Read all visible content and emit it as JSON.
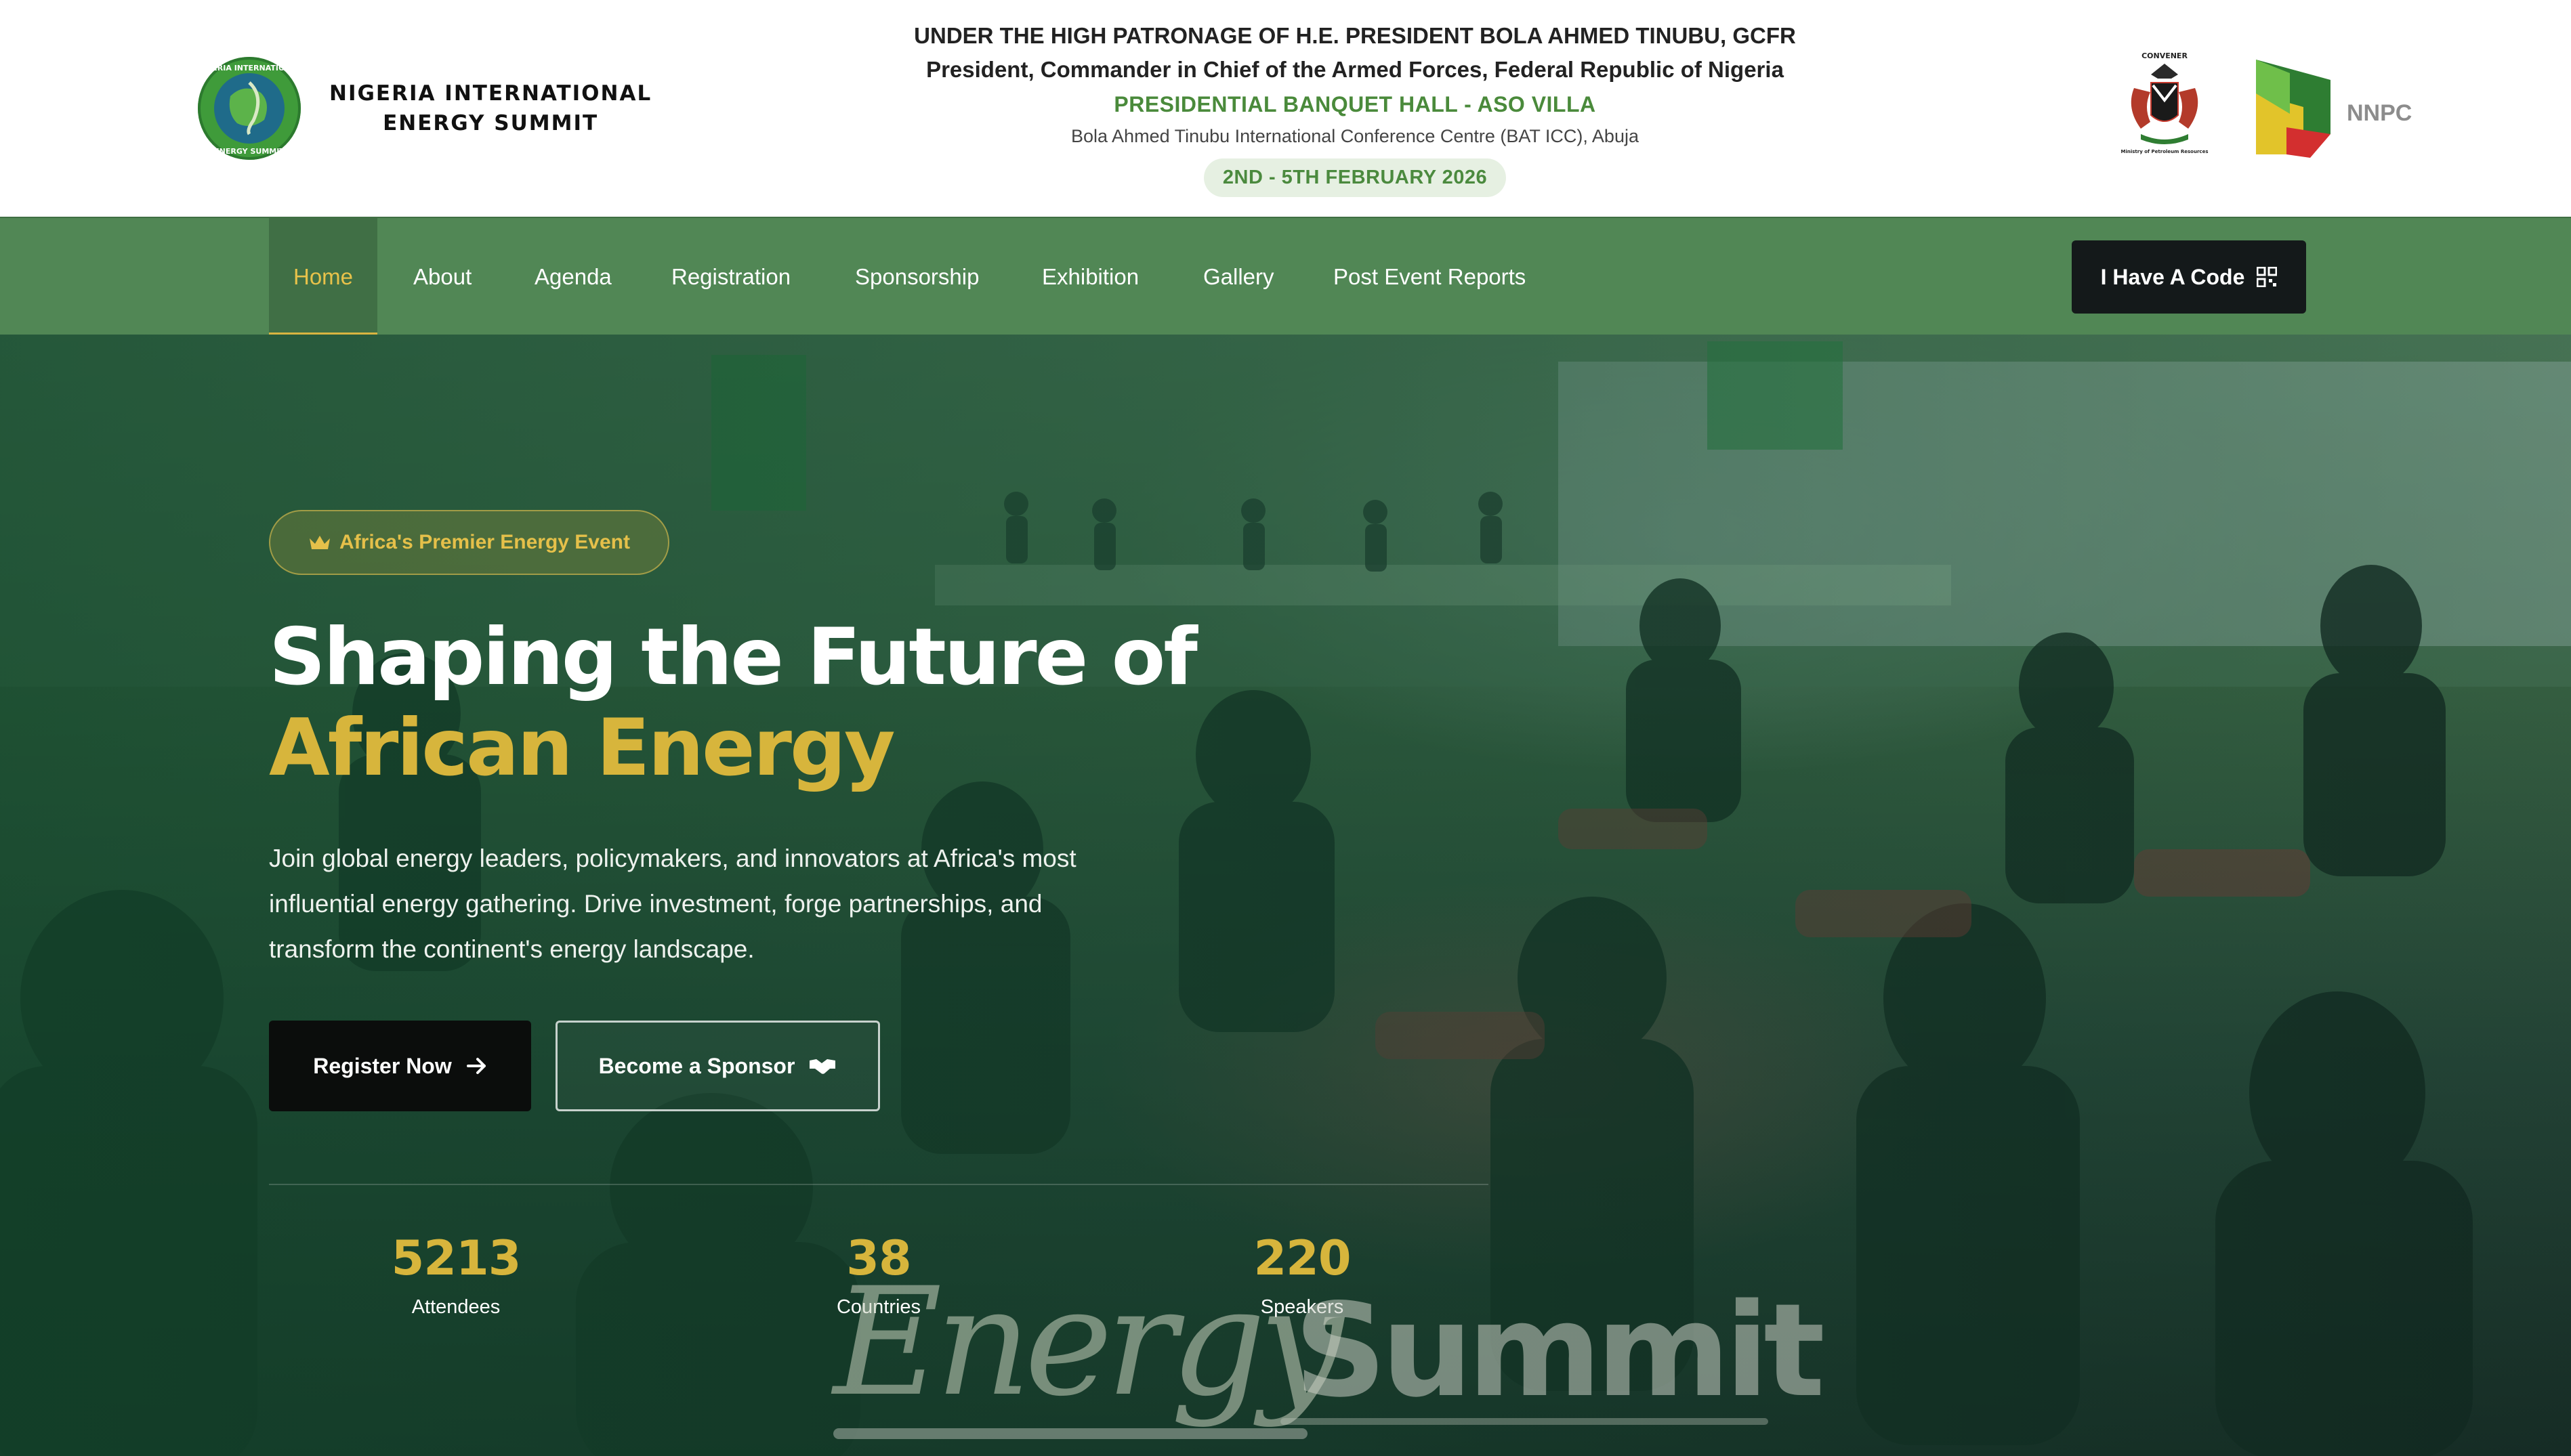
{
  "header": {
    "brand": {
      "line1": "NIGERIA INTERNATIONAL",
      "line2": "ENERGY SUMMIT",
      "logo_text_top": "NIGERIA INTERNATIONAL",
      "logo_text_bottom": "ENERGY SUMMIT"
    },
    "patronage": {
      "line1": "UNDER THE HIGH PATRONAGE OF H.E. PRESIDENT BOLA AHMED TINUBU, GCFR",
      "line2": "President, Commander in Chief of the Armed Forces, Federal Republic of Nigeria",
      "venue": "PRESIDENTIAL BANQUET HALL - ASO VILLA",
      "address": "Bola Ahmed Tinubu International Conference Centre (BAT ICC), Abuja",
      "dates": "2ND - 5TH FEBRUARY 2026"
    },
    "partners": {
      "convener_label": "CONVENER",
      "ministry_label": "Ministry of Petroleum Resources",
      "nnpc_label": "NNPC"
    }
  },
  "nav": {
    "items": [
      {
        "label": "Home",
        "active": true
      },
      {
        "label": "About"
      },
      {
        "label": "Agenda"
      },
      {
        "label": "Registration"
      },
      {
        "label": "Sponsorship"
      },
      {
        "label": "Exhibition"
      },
      {
        "label": "Gallery"
      },
      {
        "label": "Post Event Reports"
      }
    ],
    "code_button": "I Have A Code",
    "code_icon": "qr-code-icon"
  },
  "hero": {
    "badge": "Africa's Premier Energy Event",
    "badge_icon": "crown-icon",
    "title_line1": "Shaping the Future of",
    "title_line2": "African Energy",
    "description": "Join global energy leaders, policymakers, and innovators at Africa's most influential energy gathering. Drive investment, forge partnerships, and transform the continent's energy landscape.",
    "register_button": "Register Now",
    "register_icon": "arrow-right-icon",
    "sponsor_button": "Become a Sponsor",
    "sponsor_icon": "handshake-icon",
    "stats": [
      {
        "value": "5213",
        "label": "Attendees"
      },
      {
        "value": "38",
        "label": "Countries"
      },
      {
        "value": "220",
        "label": "Speakers"
      }
    ],
    "watermark": {
      "word1": "Energy",
      "word2": "Summit"
    }
  },
  "colors": {
    "nav_green": "#518755",
    "accent_gold": "#d7b53c",
    "dark_button": "#0b0d0c",
    "venue_green": "#4a8a3b"
  }
}
